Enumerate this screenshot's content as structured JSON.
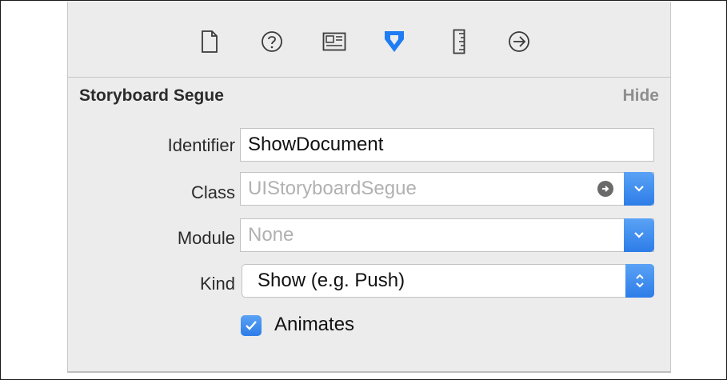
{
  "toolbar": {
    "icons": [
      {
        "name": "file-inspector-icon"
      },
      {
        "name": "quick-help-icon"
      },
      {
        "name": "identity-inspector-icon"
      },
      {
        "name": "attributes-inspector-icon",
        "selected": true
      },
      {
        "name": "size-inspector-icon"
      },
      {
        "name": "connections-inspector-icon"
      }
    ],
    "accent": "#1f7cf5"
  },
  "section": {
    "title": "Storyboard Segue",
    "hide_label": "Hide"
  },
  "fields": {
    "identifier": {
      "label": "Identifier",
      "value": "ShowDocument"
    },
    "class": {
      "label": "Class",
      "placeholder": "UIStoryboardSegue"
    },
    "module": {
      "label": "Module",
      "placeholder": "None"
    },
    "kind": {
      "label": "Kind",
      "value": "Show (e.g. Push)"
    }
  },
  "animates": {
    "label": "Animates",
    "checked": true
  }
}
